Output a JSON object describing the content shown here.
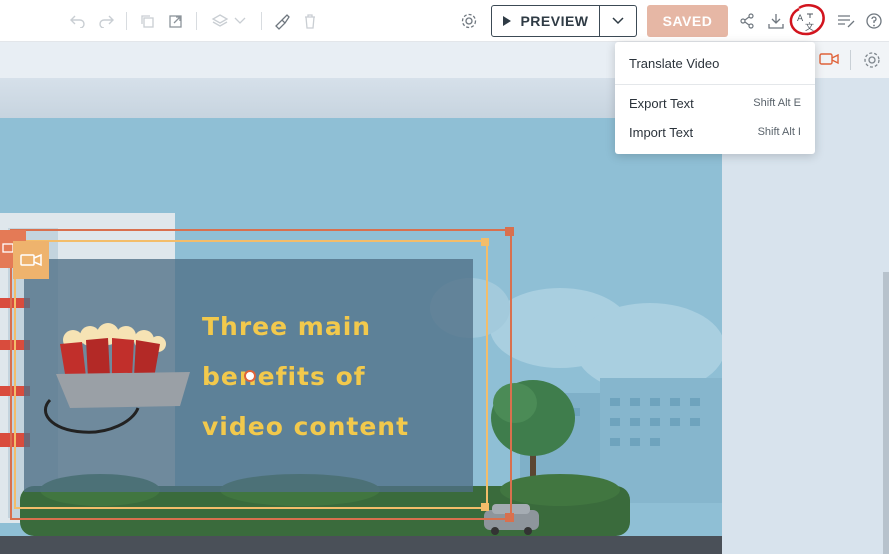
{
  "toolbar": {
    "preview_label": "PREVIEW",
    "saved_label": "SAVED"
  },
  "dropdown": {
    "items": [
      {
        "label": "Translate Video",
        "shortcut": ""
      },
      {
        "label": "Export Text",
        "shortcut": "Shift Alt E"
      },
      {
        "label": "Import Text",
        "shortcut": "Shift Alt I"
      }
    ]
  },
  "canvas": {
    "headline": [
      "Three main",
      "benefits of",
      "video content"
    ]
  },
  "colors": {
    "accent": "#e0633a",
    "saved_bg": "#e6b7a5",
    "headline": "#f2c94c",
    "annotation_circle": "#d2141e"
  }
}
